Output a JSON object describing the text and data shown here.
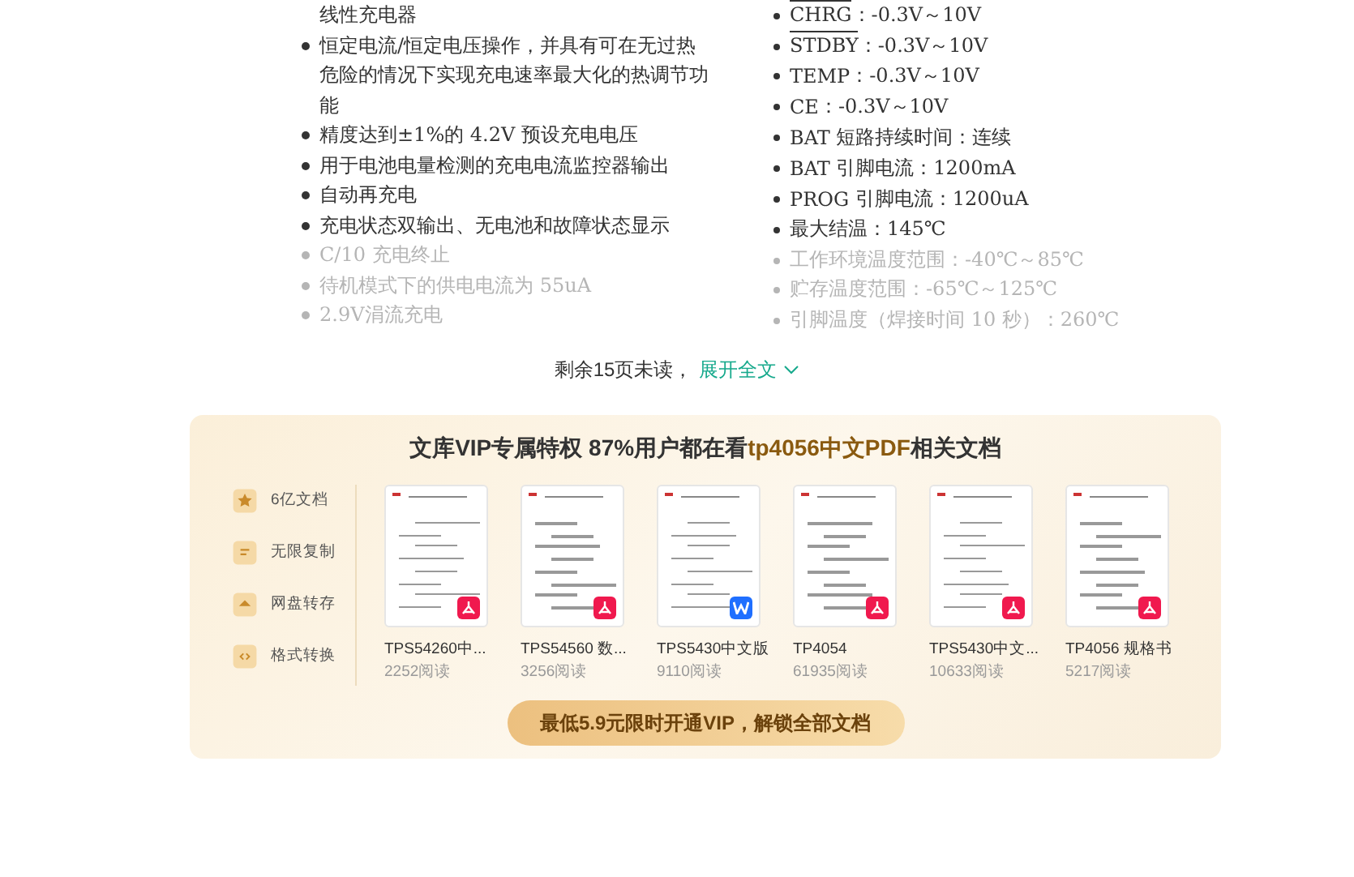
{
  "document": {
    "left_column": [
      {
        "text": "线性充电器",
        "bullet": false,
        "faded": false
      },
      {
        "text": "恒定电流/恒定电压操作，并具有可在无过热危险的情况下实现充电速率最大化的热调节功能",
        "bullet": true,
        "faded": false
      },
      {
        "text": "精度达到±1%的 4.2V 预设充电电压",
        "bullet": true,
        "faded": false
      },
      {
        "text": "用于电池电量检测的充电电流监控器输出",
        "bullet": true,
        "faded": false
      },
      {
        "text": "自动再充电",
        "bullet": true,
        "faded": false
      },
      {
        "text": "充电状态双输出、无电池和故障状态显示",
        "bullet": true,
        "faded": false
      },
      {
        "text": "C/10 充电终止",
        "bullet": true,
        "faded": true
      },
      {
        "text": "待机模式下的供电电流为 55uA",
        "bullet": true,
        "faded": true
      },
      {
        "text": "2.9V涓流充电",
        "bullet": true,
        "faded": true
      }
    ],
    "right_column": [
      {
        "pin": "CHRG",
        "overline": true,
        "text": "：-0.3V～10V",
        "faded": false
      },
      {
        "pin": "STDBY",
        "overline": true,
        "text": "：-0.3V～10V",
        "faded": false
      },
      {
        "pin": "TEMP",
        "overline": false,
        "text": "：-0.3V～10V",
        "faded": false
      },
      {
        "pin": "CE",
        "overline": false,
        "text": "：-0.3V～10V",
        "faded": false
      },
      {
        "pin": "BAT",
        "overline": false,
        "text": " 短路持续时间：连续",
        "faded": false
      },
      {
        "pin": "BAT",
        "overline": false,
        "text": " 引脚电流：1200mA",
        "faded": false
      },
      {
        "pin": "PROG",
        "overline": false,
        "text": " 引脚电流：1200uA",
        "faded": false
      },
      {
        "text": "最大结温：145℃",
        "faded": false
      },
      {
        "text": "工作环境温度范围：-40℃～85℃",
        "faded": true
      },
      {
        "text": "贮存温度范围：-65℃～125℃",
        "faded": true
      },
      {
        "text": "引脚温度（焊接时间 10 秒）：260℃",
        "faded": true
      }
    ]
  },
  "remaining": {
    "text": "剩余15页未读，",
    "link": "展开全文"
  },
  "vip": {
    "title_prefix": "文库VIP专属特权 87%用户都在看",
    "title_highlight": "tp4056中文PDF",
    "title_suffix": "相关文档",
    "features": [
      "6亿文档",
      "无限复制",
      "网盘转存",
      "格式转换"
    ],
    "docs": [
      {
        "title": "TPS54260中...",
        "reads": "2252阅读",
        "kind": "pdf"
      },
      {
        "title": "TPS54560 数...",
        "reads": "3256阅读",
        "kind": "pdf"
      },
      {
        "title": "TPS5430中文版",
        "reads": "9110阅读",
        "kind": "word"
      },
      {
        "title": "TP4054",
        "reads": "61935阅读",
        "kind": "pdf"
      },
      {
        "title": "TPS5430中文...",
        "reads": "10633阅读",
        "kind": "pdf"
      },
      {
        "title": "TP4056 规格书",
        "reads": "5217阅读",
        "kind": "pdf"
      }
    ],
    "button": "最低5.9元限时开通VIP，解锁全部文档"
  }
}
